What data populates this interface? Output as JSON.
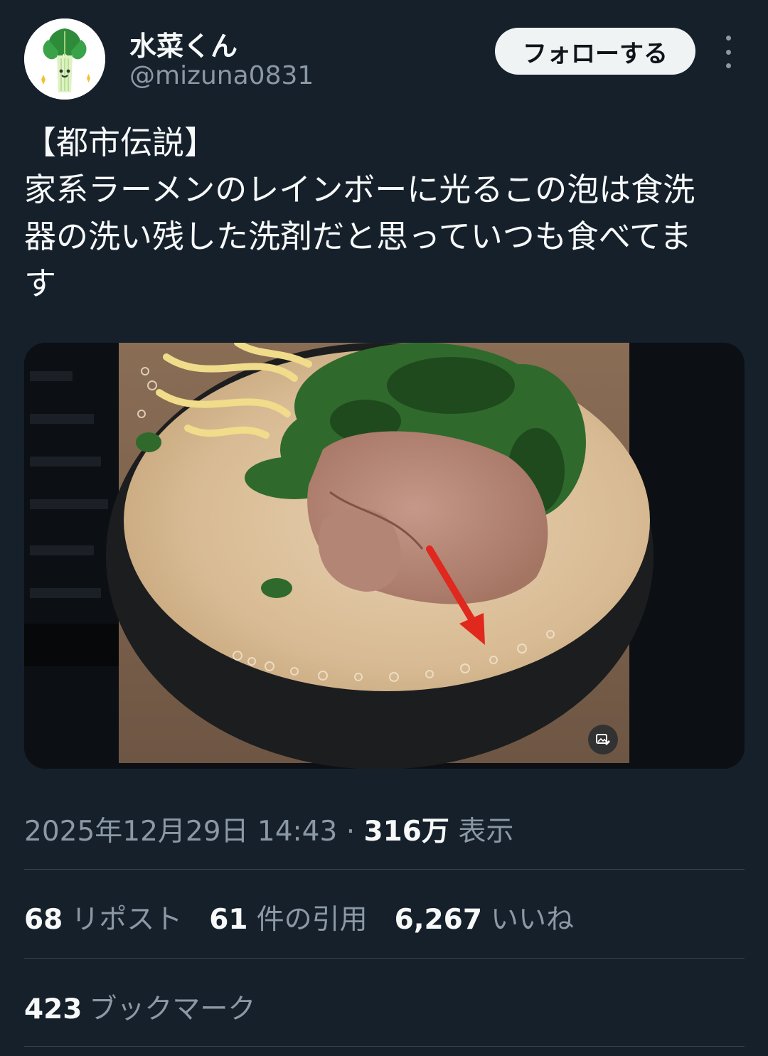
{
  "author": {
    "name": "水菜くん",
    "handle": "@mizuna0831",
    "avatar_icon": "mizuna-vegetable-character-icon"
  },
  "header": {
    "follow_label": "フォローする",
    "more_icon": "more-vertical-icon"
  },
  "tweet": {
    "lines": [
      "【都市伝説】",
      "家系ラーメンのレインボーに光るこの泡は食洗",
      "器の洗い残した洗剤だと思っていつも食べてま",
      "す"
    ]
  },
  "media": {
    "description_icon": "ramen-photo",
    "alt_icon": "image-alt-icon"
  },
  "meta": {
    "timestamp": "2025年12月29日 14:43",
    "separator": " · ",
    "views_count": "316万",
    "views_label": "表示"
  },
  "stats": {
    "reposts_count": "68",
    "reposts_label": "リポスト",
    "quotes_count": "61",
    "quotes_label": "件の引用",
    "likes_count": "6,267",
    "likes_label": "いいね",
    "bookmarks_count": "423",
    "bookmarks_label": "ブックマーク"
  },
  "colors": {
    "background": "#15202b",
    "text_primary": "#f7f9f9",
    "text_secondary": "#8b98a5",
    "divider": "#38444d",
    "follow_bg": "#eff3f4",
    "arrow": "#e0281e"
  }
}
